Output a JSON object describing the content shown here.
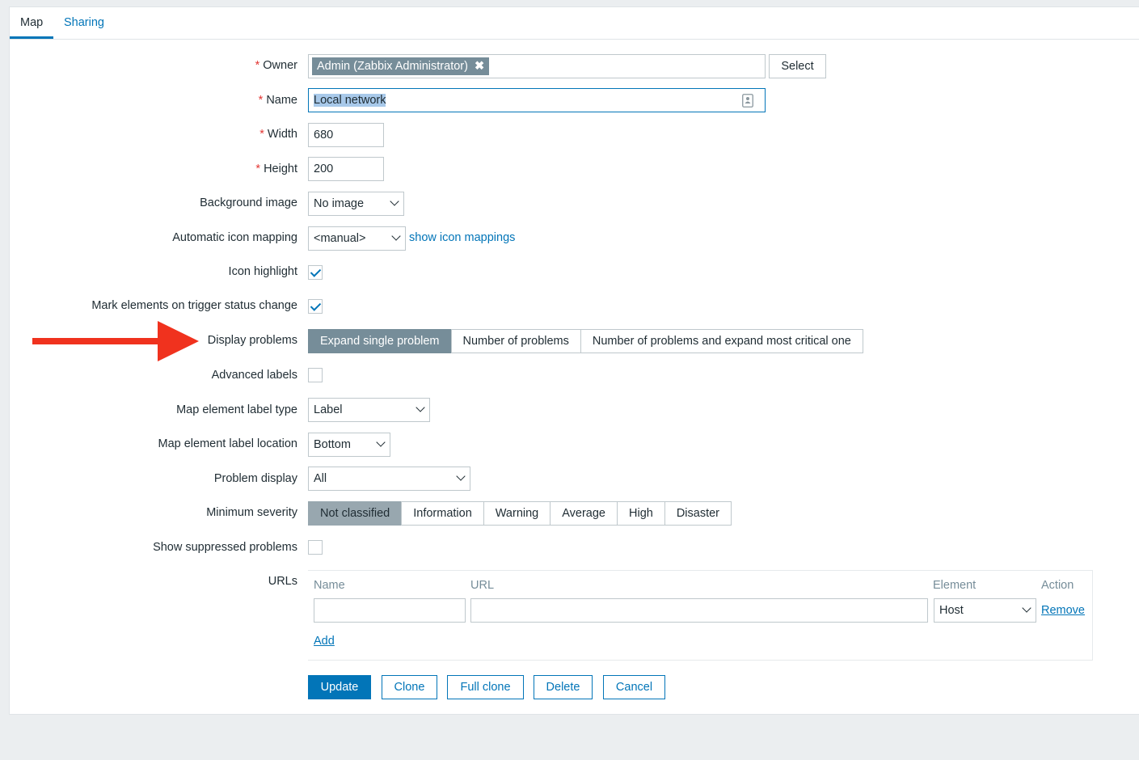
{
  "tabs": [
    {
      "label": "Map",
      "active": true
    },
    {
      "label": "Sharing",
      "active": false
    }
  ],
  "form": {
    "owner": {
      "label": "Owner",
      "value": "Admin (Zabbix Administrator)",
      "remove_glyph": "✖",
      "select_label": "Select"
    },
    "name": {
      "label": "Name",
      "value": "Local network"
    },
    "width": {
      "label": "Width",
      "value": "680"
    },
    "height": {
      "label": "Height",
      "value": "200"
    },
    "background_image": {
      "label": "Background image",
      "value": "No image"
    },
    "icon_mapping": {
      "label": "Automatic icon mapping",
      "value": "<manual>",
      "link": "show icon mappings"
    },
    "icon_highlight": {
      "label": "Icon highlight",
      "checked": true
    },
    "mark_elements": {
      "label": "Mark elements on trigger status change",
      "checked": true
    },
    "display_problems": {
      "label": "Display problems",
      "options": [
        "Expand single problem",
        "Number of problems",
        "Number of problems and expand most critical one"
      ],
      "selected": "Expand single problem"
    },
    "advanced_labels": {
      "label": "Advanced labels",
      "checked": false
    },
    "label_type": {
      "label": "Map element label type",
      "value": "Label"
    },
    "label_location": {
      "label": "Map element label location",
      "value": "Bottom"
    },
    "problem_display": {
      "label": "Problem display",
      "value": "All"
    },
    "minimum_severity": {
      "label": "Minimum severity",
      "options": [
        "Not classified",
        "Information",
        "Warning",
        "Average",
        "High",
        "Disaster"
      ],
      "selected": "Not classified"
    },
    "show_suppressed": {
      "label": "Show suppressed problems",
      "checked": false
    },
    "urls": {
      "label": "URLs",
      "headers": {
        "name": "Name",
        "url": "URL",
        "element": "Element",
        "action": "Action"
      },
      "row": {
        "name": "",
        "url": "",
        "element": "Host",
        "remove": "Remove"
      },
      "add": "Add"
    }
  },
  "buttons": {
    "update": "Update",
    "clone": "Clone",
    "full_clone": "Full clone",
    "delete": "Delete",
    "cancel": "Cancel"
  },
  "colors": {
    "accent": "#0275b8",
    "selected_segment": "#768d99",
    "required": "#e33734",
    "annotation_arrow": "#f0321e"
  }
}
